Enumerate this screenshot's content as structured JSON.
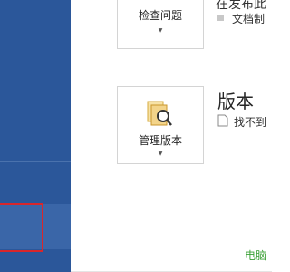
{
  "main": {
    "check_issues": {
      "label": "检查问题",
      "caret": "▼"
    },
    "top_section": {
      "title_partial": "在发布此",
      "item_partial": "文档制"
    },
    "manage_versions": {
      "label": "管理版本",
      "caret": "▼"
    },
    "versions_section": {
      "title": "版本",
      "text_partial": "找不到"
    }
  },
  "watermark": "电脑"
}
